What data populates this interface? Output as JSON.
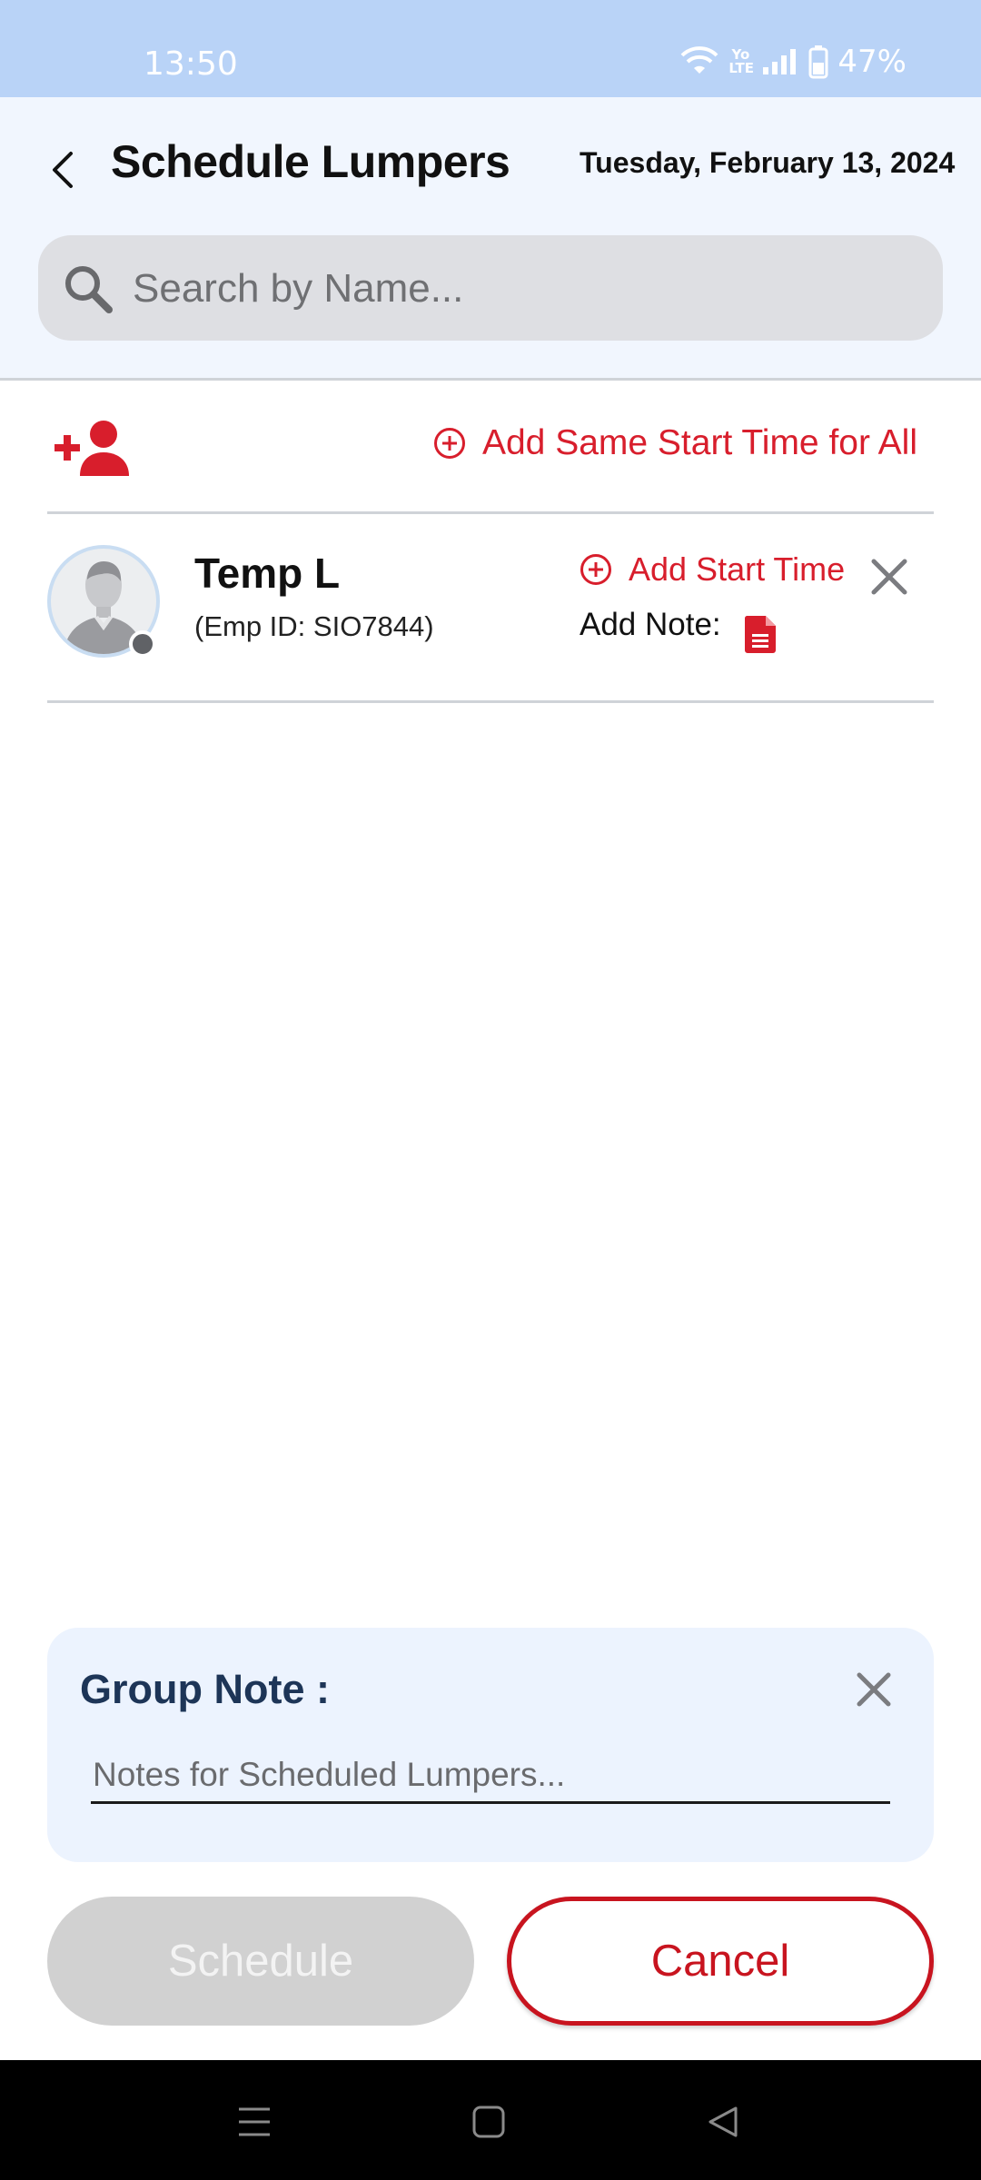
{
  "status_bar": {
    "time": "13:50",
    "volte": "Yo\nLTE",
    "battery": "47%",
    "icons": [
      "wifi-icon",
      "volte-icon",
      "signal-icon",
      "battery-icon"
    ]
  },
  "header": {
    "title": "Schedule Lumpers",
    "date": "Tuesday, February 13, 2024",
    "back_icon": "back-arrow-icon"
  },
  "search": {
    "placeholder": "Search by Name...",
    "value": ""
  },
  "toolbar": {
    "add_person_icon": "add-person-icon",
    "add_all_label": "Add Same Start Time for All"
  },
  "lumpers": [
    {
      "name": "Temp L",
      "emp_id": "(Emp ID: SIO7844)",
      "add_start_label": "Add Start Time",
      "add_note_label": "Add Note:",
      "status": "offline"
    }
  ],
  "group_note": {
    "title": "Group Note :",
    "placeholder": "Notes for Scheduled Lumpers...",
    "value": ""
  },
  "actions": {
    "schedule_label": "Schedule",
    "cancel_label": "Cancel"
  },
  "colors": {
    "accent_red": "#d81e2c",
    "header_bg": "#f1f6fe",
    "status_bar_bg": "#b9d3f7",
    "note_title": "#1d3557",
    "disabled_button": "#d1d1d1"
  },
  "nav_bar": {
    "icons": [
      "menu-icon",
      "home-icon",
      "back-icon"
    ]
  }
}
